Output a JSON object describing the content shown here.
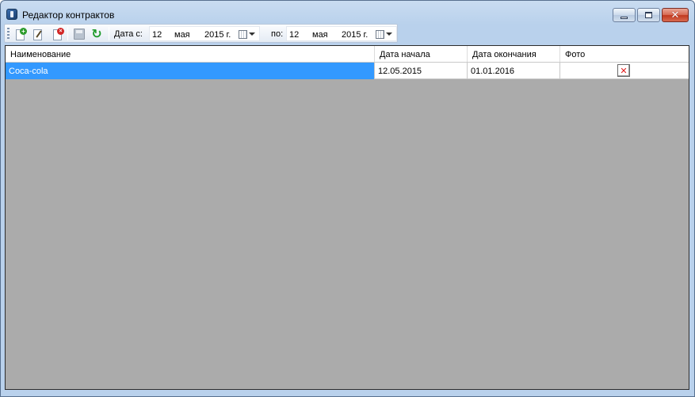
{
  "window": {
    "title": "Редактор контрактов",
    "icons": {
      "app": "app-icon",
      "minimize": "minimize-icon",
      "maximize": "maximize-icon",
      "close": "close-icon"
    }
  },
  "toolbar": {
    "icons": {
      "add": "add-document-icon",
      "edit": "edit-document-icon",
      "delete": "delete-document-icon",
      "save": "save-disk-icon",
      "refresh": "refresh-icon"
    },
    "date_from_label": "Дата с:",
    "date_from": {
      "day": "12",
      "month": "мая",
      "year": "2015 г."
    },
    "date_to_label": "по:",
    "date_to": {
      "day": "12",
      "month": "мая",
      "year": "2015 г."
    }
  },
  "grid": {
    "columns": [
      "Наименование",
      "Дата начала",
      "Дата окончания",
      "Фото"
    ],
    "rows": [
      {
        "name": "Coca-cola",
        "start": "12.05.2015",
        "end": "01.01.2016",
        "photo": ""
      }
    ],
    "photo_clear_glyph": "✕"
  },
  "colors": {
    "selection": "#3399ff",
    "grid_background": "#ababab",
    "clear_icon": "#e01a1a"
  }
}
